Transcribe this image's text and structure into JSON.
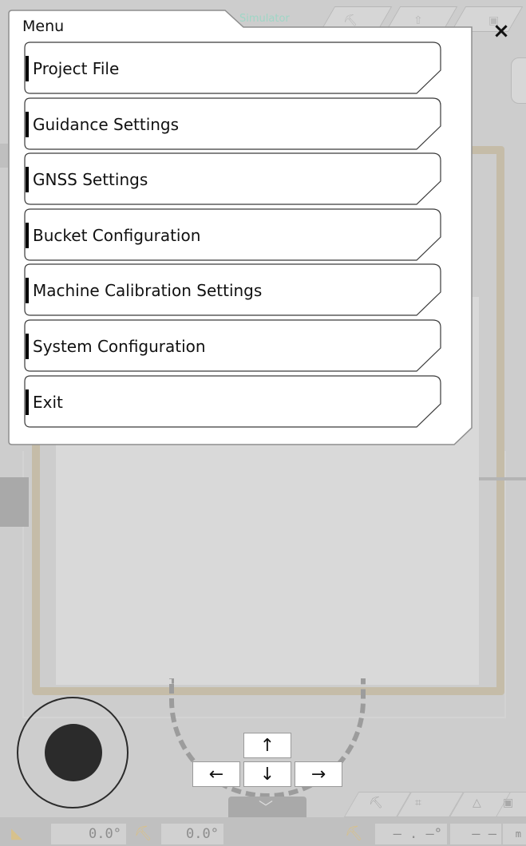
{
  "background": {
    "sim_label": "Simulator",
    "readouts": [
      "0.0°",
      "0.0°",
      "— . —°",
      "— —"
    ],
    "unit": "m",
    "bottom_tab_glyph": "﹀"
  },
  "menu": {
    "title": "Menu",
    "close_glyph": "×",
    "items": [
      {
        "label": "Project File"
      },
      {
        "label": "Guidance Settings"
      },
      {
        "label": "GNSS Settings"
      },
      {
        "label": "Bucket Configuration"
      },
      {
        "label": "Machine Calibration Settings"
      },
      {
        "label": "System Configuration"
      },
      {
        "label": "Exit"
      }
    ]
  },
  "controls": {
    "up": "↑",
    "down": "↓",
    "left": "←",
    "right": "→"
  },
  "colors": {
    "accent_frame": "#c5bca8",
    "joystick": "#2b2b2b",
    "menu_bg": "#ffffff"
  },
  "icons": [
    "close-icon",
    "joystick-icon",
    "arrow-up-icon",
    "arrow-down-icon",
    "arrow-left-icon",
    "arrow-right-icon"
  ]
}
